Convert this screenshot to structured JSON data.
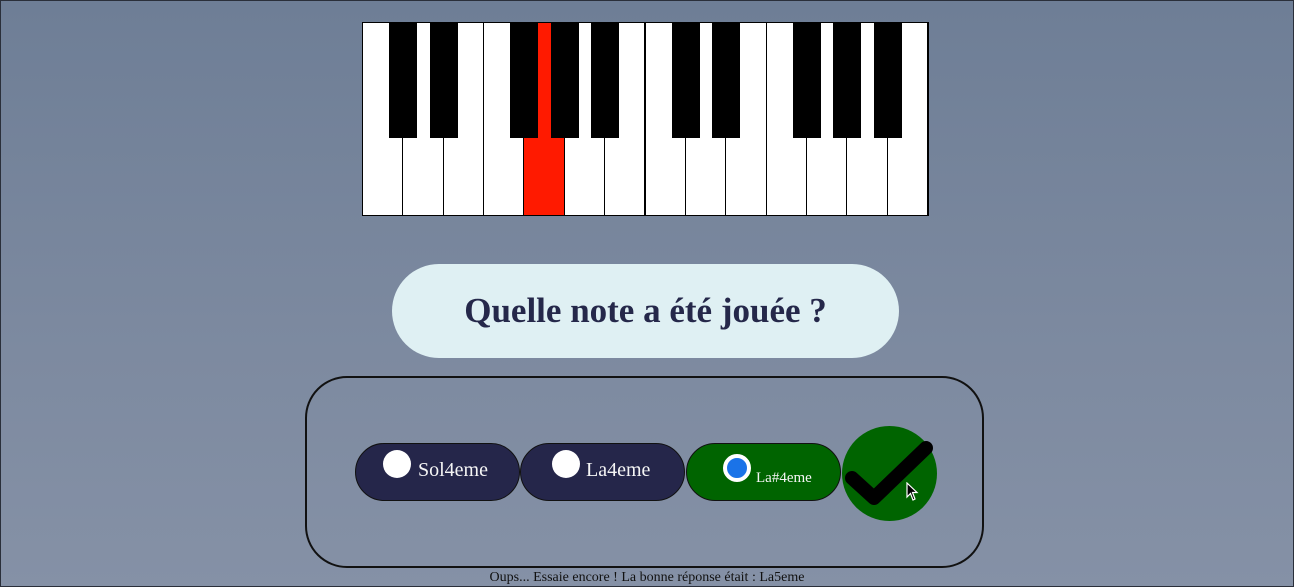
{
  "piano": {
    "white_keys": 14,
    "black_key_positions_after_white": [
      1,
      2,
      4,
      5,
      6,
      8,
      9,
      11,
      12,
      13
    ],
    "highlighted_white_key_index": 4,
    "highlight_color": "#ff1a00"
  },
  "question": {
    "text": "Quelle note a été jouée ?"
  },
  "options": [
    {
      "label": "Sol4eme",
      "selected": false
    },
    {
      "label": "La4eme",
      "selected": false
    },
    {
      "label": "La#4eme",
      "selected": true
    }
  ],
  "validate": {
    "icon": "checkmark-icon",
    "color": "#006400"
  },
  "feedback": {
    "text": "Oups... Essaie encore ! La bonne réponse était : La5eme"
  }
}
